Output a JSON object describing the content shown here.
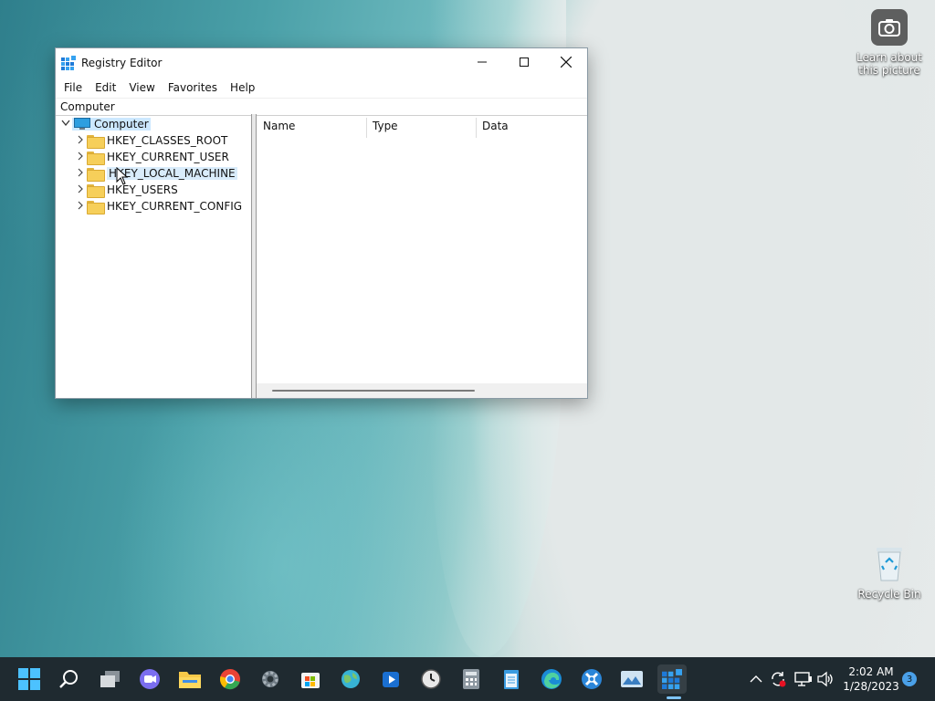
{
  "desktop": {
    "learn_icon_label_line1": "Learn about",
    "learn_icon_label_line2": "this picture",
    "recycle_label": "Recycle Bin"
  },
  "window": {
    "title": "Registry Editor",
    "menu": [
      "File",
      "Edit",
      "View",
      "Favorites",
      "Help"
    ],
    "address": "Computer",
    "tree": {
      "root": "Computer",
      "keys": [
        "HKEY_CLASSES_ROOT",
        "HKEY_CURRENT_USER",
        "HKEY_LOCAL_MACHINE",
        "HKEY_USERS",
        "HKEY_CURRENT_CONFIG"
      ],
      "highlighted": "HKEY_LOCAL_MACHINE"
    },
    "columns": [
      "Name",
      "Type",
      "Data"
    ]
  },
  "taskbar": {
    "apps": [
      "start",
      "search",
      "task-view",
      "chat",
      "file-explorer",
      "chrome",
      "settings",
      "microsoft-store",
      "maps",
      "media-player",
      "clock-app",
      "calculator",
      "notepad",
      "edge",
      "app-tools",
      "photos",
      "registry-editor"
    ],
    "clock_time": "2:02 AM",
    "clock_date": "1/28/2023",
    "notification_count": "3"
  }
}
